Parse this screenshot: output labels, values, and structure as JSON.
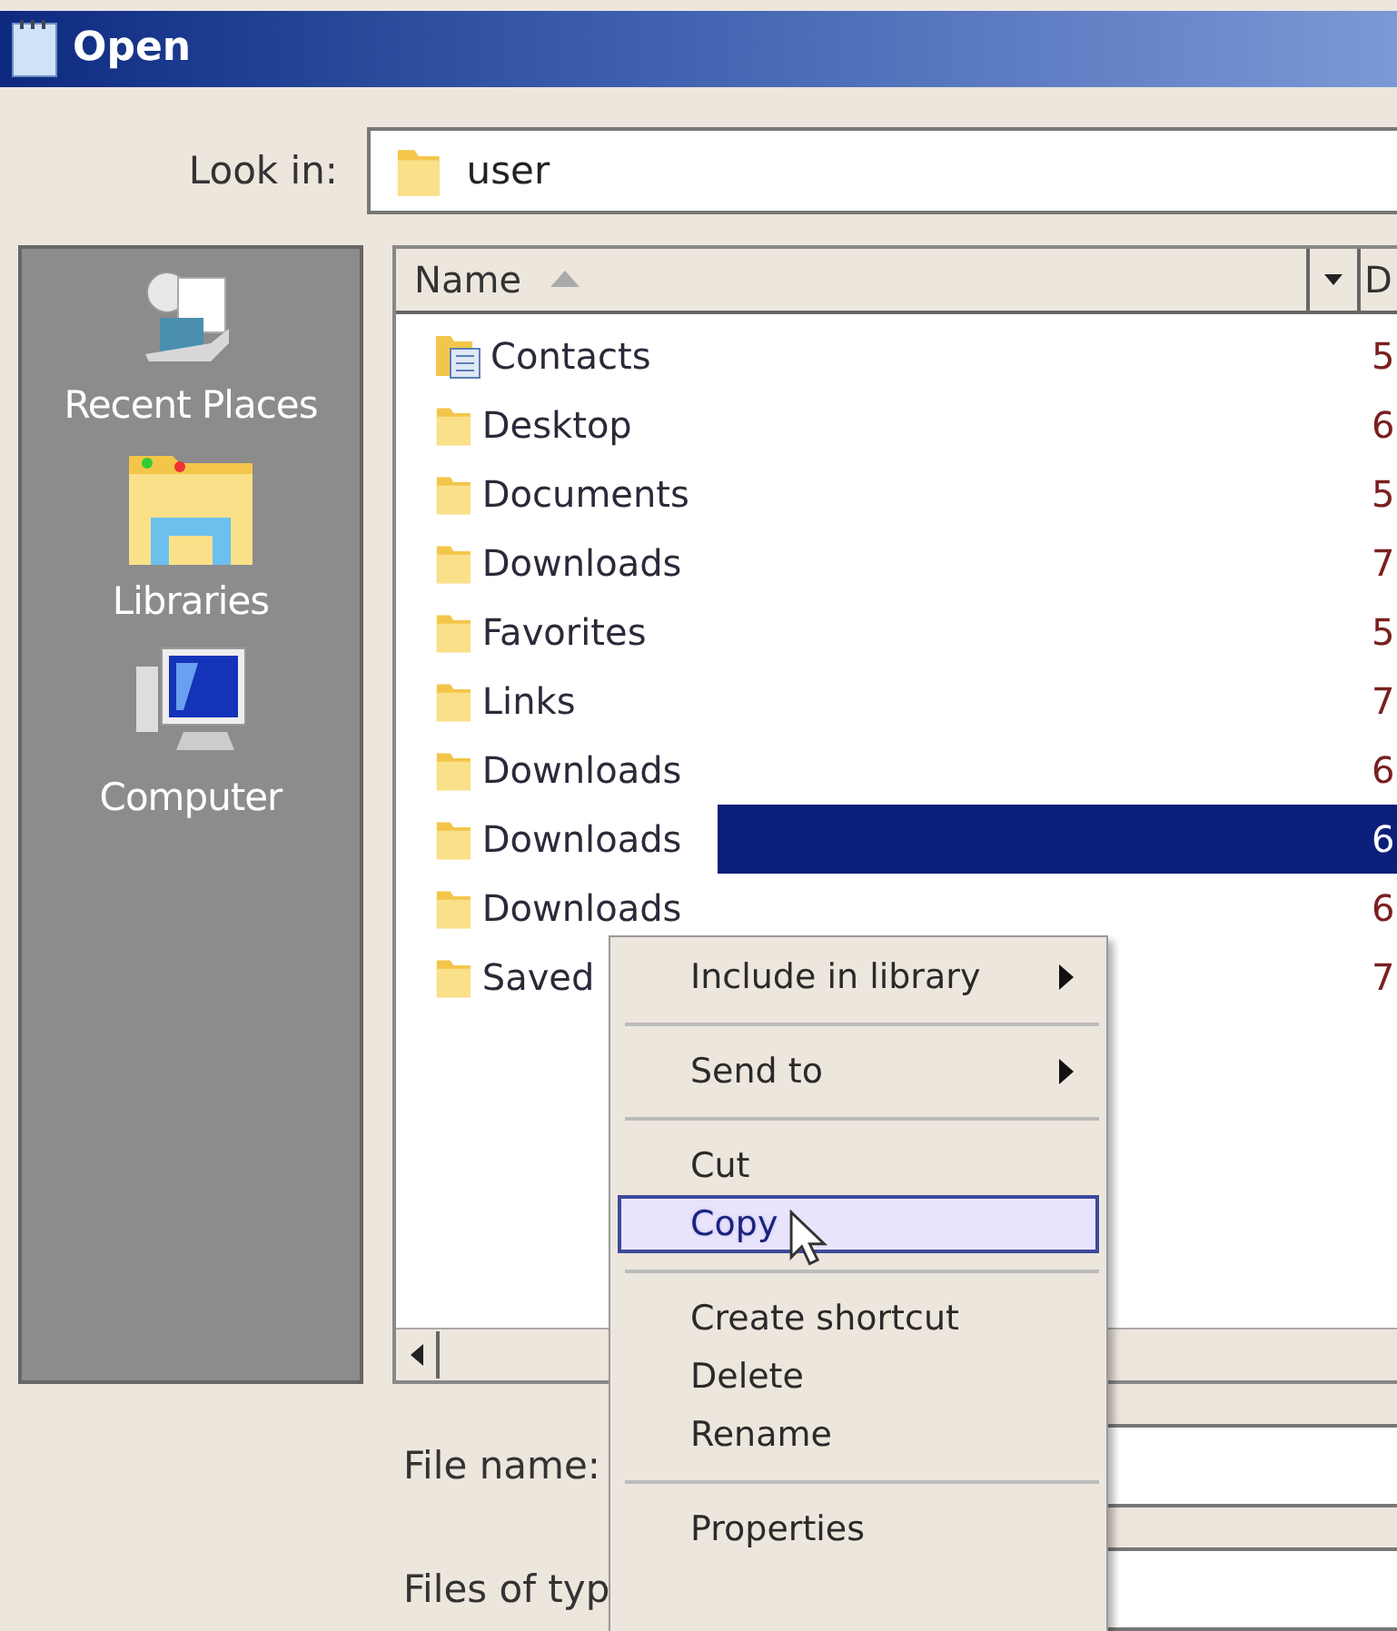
{
  "window": {
    "title": "Open"
  },
  "look_in": {
    "label": "Look in:",
    "value": "user"
  },
  "sidebar": {
    "items": [
      {
        "label": "Recent Places",
        "kind": "recent"
      },
      {
        "label": "Libraries",
        "kind": "libraries"
      },
      {
        "label": "Computer",
        "kind": "computer"
      }
    ]
  },
  "file_list": {
    "columns": [
      {
        "label": "Name",
        "sorted": true
      },
      {
        "label": "D"
      }
    ],
    "rows": [
      {
        "name": "Contacts",
        "kind": "contacts",
        "column_2": "5",
        "selected": false
      },
      {
        "name": "Desktop",
        "kind": "folder",
        "column_2": "6",
        "selected": false
      },
      {
        "name": "Documents",
        "kind": "folder",
        "column_2": "5",
        "selected": false
      },
      {
        "name": "Downloads",
        "kind": "folder",
        "column_2": "7",
        "selected": false
      },
      {
        "name": "Favorites",
        "kind": "folder",
        "column_2": "5",
        "selected": false
      },
      {
        "name": "Links",
        "kind": "folder",
        "column_2": "7",
        "selected": false
      },
      {
        "name": "Downloads",
        "kind": "folder",
        "column_2": "6",
        "selected": false
      },
      {
        "name": "Downloads",
        "kind": "folder",
        "column_2": "6",
        "selected": true
      },
      {
        "name": "Downloads",
        "kind": "folder",
        "column_2": "6",
        "selected": false
      },
      {
        "name": "Saved",
        "kind": "folder",
        "column_2": "7",
        "selected": false
      }
    ]
  },
  "file_name": {
    "label": "File name:"
  },
  "files_of_type": {
    "label": "Files of typ"
  },
  "context_menu": {
    "items": [
      {
        "kind": "submenu",
        "label": "Include in library",
        "selected": false
      },
      {
        "kind": "separator"
      },
      {
        "kind": "submenu",
        "label": "Send to",
        "selected": false
      },
      {
        "kind": "separator"
      },
      {
        "kind": "item",
        "label": "Cut",
        "selected": false
      },
      {
        "kind": "item",
        "label": "Copy",
        "selected": true
      },
      {
        "kind": "separator"
      },
      {
        "kind": "item",
        "label": "Create shortcut",
        "selected": false
      },
      {
        "kind": "item",
        "label": "Delete",
        "selected": false
      },
      {
        "kind": "item",
        "label": "Rename",
        "selected": false
      },
      {
        "kind": "separator"
      },
      {
        "kind": "item",
        "label": "Properties",
        "selected": false
      }
    ]
  }
}
